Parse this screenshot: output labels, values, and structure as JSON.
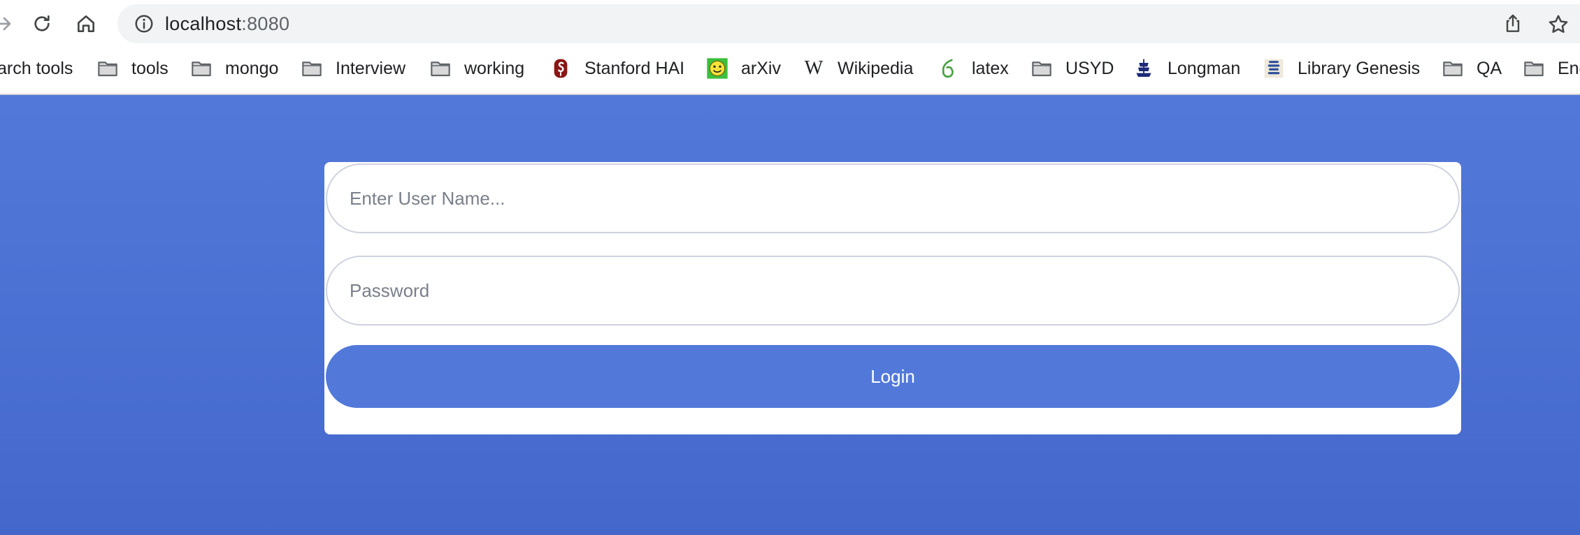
{
  "browser": {
    "address_bar": {
      "host": "localhost",
      "port": ":8080"
    },
    "bookmarks": [
      {
        "label": "arch tools",
        "icon": "none"
      },
      {
        "label": "tools",
        "icon": "folder-icon"
      },
      {
        "label": "mongo",
        "icon": "folder-icon"
      },
      {
        "label": "Interview",
        "icon": "folder-icon"
      },
      {
        "label": "working",
        "icon": "folder-icon"
      },
      {
        "label": "Stanford HAI",
        "icon": "stanford-logo-icon"
      },
      {
        "label": "arXiv",
        "icon": "arxiv-smiley-icon"
      },
      {
        "label": "Wikipedia",
        "icon": "wikipedia-w-icon"
      },
      {
        "label": "latex",
        "icon": "overleaf-leaf-icon"
      },
      {
        "label": "USYD",
        "icon": "folder-icon"
      },
      {
        "label": "Longman",
        "icon": "longman-ship-icon"
      },
      {
        "label": "Library Genesis",
        "icon": "library-genesis-icon"
      },
      {
        "label": "QA",
        "icon": "folder-icon"
      },
      {
        "label": "Eng",
        "icon": "folder-icon"
      }
    ]
  },
  "login_form": {
    "username_placeholder": "Enter User Name...",
    "password_placeholder": "Password",
    "username_value": "",
    "password_value": "",
    "login_label": "Login"
  },
  "colors": {
    "page_background": "#5279da",
    "button": "#5279da",
    "card": "#ffffff"
  }
}
